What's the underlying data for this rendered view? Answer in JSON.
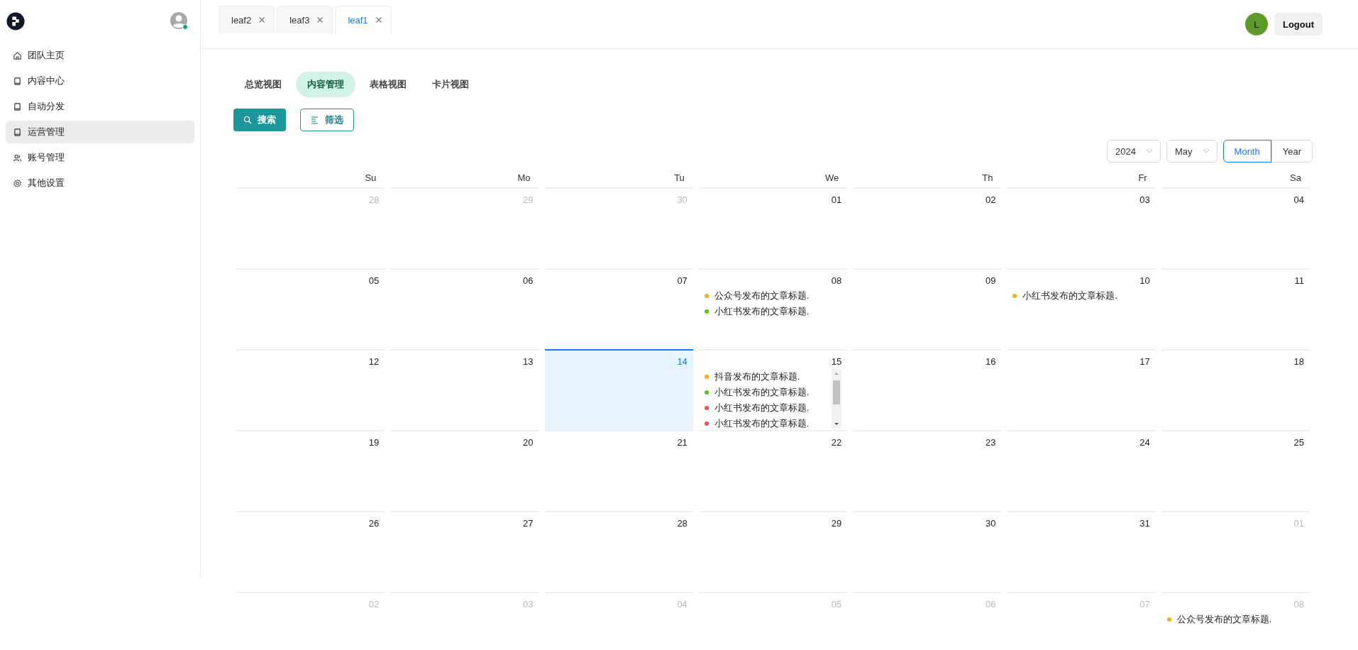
{
  "sidebar": {
    "items": [
      {
        "label": "团队主页",
        "kind": "home",
        "selected": false
      },
      {
        "label": "内容中心",
        "kind": "book",
        "selected": false
      },
      {
        "label": "自动分发",
        "kind": "book",
        "selected": false
      },
      {
        "label": "运营管理",
        "kind": "book",
        "selected": true
      },
      {
        "label": "账号管理",
        "kind": "users",
        "selected": false
      },
      {
        "label": "其他设置",
        "kind": "gear",
        "selected": false
      }
    ]
  },
  "tabs": [
    {
      "label": "leaf2",
      "selected": false
    },
    {
      "label": "leaf3",
      "selected": false
    },
    {
      "label": "leaf1",
      "selected": true
    }
  ],
  "user": {
    "initial": "L",
    "logout": "Logout"
  },
  "view_tabs": [
    {
      "label": "总览视图",
      "selected": false
    },
    {
      "label": "内容管理",
      "selected": true
    },
    {
      "label": "表格视图",
      "selected": false
    },
    {
      "label": "卡片视图",
      "selected": false
    }
  ],
  "actions": {
    "search": "搜索",
    "filter": "筛选"
  },
  "calendar": {
    "year": "2024",
    "month": "May",
    "modes": [
      {
        "label": "Month",
        "selected": true
      },
      {
        "label": "Year",
        "selected": false
      }
    ],
    "weekdays": [
      "Su",
      "Mo",
      "Tu",
      "We",
      "Th",
      "Fr",
      "Sa"
    ],
    "weeks": [
      [
        {
          "date": "28",
          "outside": true
        },
        {
          "date": "29",
          "outside": true
        },
        {
          "date": "30",
          "outside": true
        },
        {
          "date": "01",
          "outside": false
        },
        {
          "date": "02",
          "outside": false
        },
        {
          "date": "03",
          "outside": false
        },
        {
          "date": "04",
          "outside": false
        }
      ],
      [
        {
          "date": "05",
          "outside": false
        },
        {
          "date": "06",
          "outside": false
        },
        {
          "date": "07",
          "outside": false
        },
        {
          "date": "08",
          "outside": false,
          "events": [
            {
              "title": "公众号发布的文章标题.",
              "color": "#faad14"
            },
            {
              "title": "小红书发布的文章标题.",
              "color": "#52c41a"
            }
          ]
        },
        {
          "date": "09",
          "outside": false
        },
        {
          "date": "10",
          "outside": false,
          "events": [
            {
              "title": "小红书发布的文章标题.",
              "color": "#faad14"
            }
          ]
        },
        {
          "date": "11",
          "outside": false
        }
      ],
      [
        {
          "date": "12",
          "outside": false
        },
        {
          "date": "13",
          "outside": false
        },
        {
          "date": "14",
          "outside": false,
          "today": true
        },
        {
          "date": "15",
          "outside": false,
          "scroll": true,
          "events": [
            {
              "title": "抖音发布的文章标题.",
              "color": "#faad14"
            },
            {
              "title": "小红书发布的文章标题.",
              "color": "#52c41a"
            },
            {
              "title": "小红书发布的文章标题.",
              "color": "#ff4d4f"
            },
            {
              "title": "小红书发布的文章标题.",
              "color": "#ff4d4f"
            }
          ]
        },
        {
          "date": "16",
          "outside": false
        },
        {
          "date": "17",
          "outside": false
        },
        {
          "date": "18",
          "outside": false
        }
      ],
      [
        {
          "date": "19",
          "outside": false
        },
        {
          "date": "20",
          "outside": false
        },
        {
          "date": "21",
          "outside": false
        },
        {
          "date": "22",
          "outside": false
        },
        {
          "date": "23",
          "outside": false
        },
        {
          "date": "24",
          "outside": false
        },
        {
          "date": "25",
          "outside": false
        }
      ],
      [
        {
          "date": "26",
          "outside": false
        },
        {
          "date": "27",
          "outside": false
        },
        {
          "date": "28",
          "outside": false
        },
        {
          "date": "29",
          "outside": false
        },
        {
          "date": "30",
          "outside": false
        },
        {
          "date": "31",
          "outside": false
        },
        {
          "date": "01",
          "outside": true
        }
      ],
      [
        {
          "date": "02",
          "outside": true
        },
        {
          "date": "03",
          "outside": true
        },
        {
          "date": "04",
          "outside": true
        },
        {
          "date": "05",
          "outside": true
        },
        {
          "date": "06",
          "outside": true
        },
        {
          "date": "07",
          "outside": true
        },
        {
          "date": "08",
          "outside": true,
          "events": [
            {
              "title": "公众号发布的文章标题.",
              "color": "#faad14"
            }
          ]
        }
      ]
    ]
  }
}
